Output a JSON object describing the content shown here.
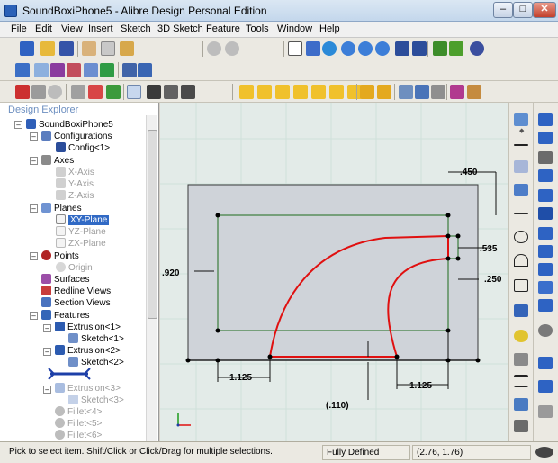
{
  "window": {
    "title": "SoundBoxiPhone5 - Alibre Design Personal Edition",
    "min_glyph": "–",
    "max_glyph": "□",
    "close_glyph": "✕"
  },
  "menu": {
    "items": [
      "File",
      "Edit",
      "View",
      "Insert",
      "Sketch",
      "3D Sketch",
      "Feature",
      "Tools",
      "Window",
      "Help"
    ]
  },
  "explorer": {
    "title": "Design Explorer",
    "tree": [
      {
        "label": "SoundBoxiPhone5",
        "icon": "part-icon",
        "state": "normal"
      },
      {
        "label": "Configurations",
        "icon": "configurations-icon",
        "state": "normal"
      },
      {
        "label": "Config<1>",
        "icon": "config-icon",
        "state": "normal"
      },
      {
        "label": "Axes",
        "icon": "axes-icon",
        "state": "normal"
      },
      {
        "label": "X-Axis",
        "icon": "axis-icon",
        "state": "dim"
      },
      {
        "label": "Y-Axis",
        "icon": "axis-icon",
        "state": "dim"
      },
      {
        "label": "Z-Axis",
        "icon": "axis-icon",
        "state": "dim"
      },
      {
        "label": "Planes",
        "icon": "planes-icon",
        "state": "normal"
      },
      {
        "label": "XY-Plane",
        "icon": "plane-icon",
        "state": "selected"
      },
      {
        "label": "YZ-Plane",
        "icon": "plane-icon",
        "state": "dim"
      },
      {
        "label": "ZX-Plane",
        "icon": "plane-icon",
        "state": "dim"
      },
      {
        "label": "Points",
        "icon": "points-icon",
        "state": "normal"
      },
      {
        "label": "Origin",
        "icon": "origin-icon",
        "state": "dim"
      },
      {
        "label": "Surfaces",
        "icon": "surfaces-icon",
        "state": "normal"
      },
      {
        "label": "Redline Views",
        "icon": "redline-views-icon",
        "state": "normal"
      },
      {
        "label": "Section Views",
        "icon": "section-views-icon",
        "state": "normal"
      },
      {
        "label": "Features",
        "icon": "features-icon",
        "state": "normal"
      },
      {
        "label": "Extrusion<1>",
        "icon": "extrusion-icon",
        "state": "normal"
      },
      {
        "label": "Sketch<1>",
        "icon": "sketch-icon",
        "state": "normal"
      },
      {
        "label": "Extrusion<2>",
        "icon": "extrusion-icon",
        "state": "normal"
      },
      {
        "label": "Sketch<2>",
        "icon": "sketch-icon",
        "state": "normal"
      },
      {
        "label": "",
        "icon": "rollback-marker-icon",
        "state": "normal"
      },
      {
        "label": "Extrusion<3>",
        "icon": "extrusion-icon",
        "state": "dim"
      },
      {
        "label": "Sketch<3>",
        "icon": "sketch-icon",
        "state": "dim"
      },
      {
        "label": "Fillet<4>",
        "icon": "fillet-icon",
        "state": "dim"
      },
      {
        "label": "Fillet<5>",
        "icon": "fillet-icon",
        "state": "dim"
      },
      {
        "label": "Fillet<6>",
        "icon": "fillet-icon",
        "state": "dim"
      }
    ]
  },
  "sketch": {
    "dimensions": [
      ".450",
      ".535",
      ".920",
      ".250",
      "1.125",
      "1.125",
      "(.110)"
    ],
    "colors": {
      "canvas_bg": "#e3ebe8",
      "face_fill": "#cfd3d9",
      "sketch_line": "#1c6b1c",
      "profile_curve": "#e01010",
      "grid": "#cfe0da"
    }
  },
  "status": {
    "hint": "Pick to select item. Shift/Click or Click/Drag for multiple selections.",
    "sketch_state": "Fully Defined",
    "coordinates": "(2.76, 1.76)"
  },
  "toolbar_icons": {
    "row1": [
      "new-icon",
      "open-icon",
      "save-icon",
      "cut-icon",
      "copy-icon",
      "paste-icon",
      "undo-icon",
      "redo-icon",
      "select-icon",
      "zoom-in-icon",
      "zoom-out-icon",
      "zoom-window-icon",
      "previous-view-icon",
      "next-view-icon",
      "render-icon"
    ],
    "row2": [
      "sketch-plane-icon",
      "line-icon",
      "constraint-icon",
      "list-icon",
      "insert-icon",
      "measure-icon",
      "material-icon"
    ],
    "row3": [
      "dimension-icon",
      "reference-icon",
      "view-icon",
      "style-icon",
      "grid-icon",
      "axes-toggle-icon",
      "box-views-icon",
      "section-icon",
      "analysis-icon"
    ]
  }
}
